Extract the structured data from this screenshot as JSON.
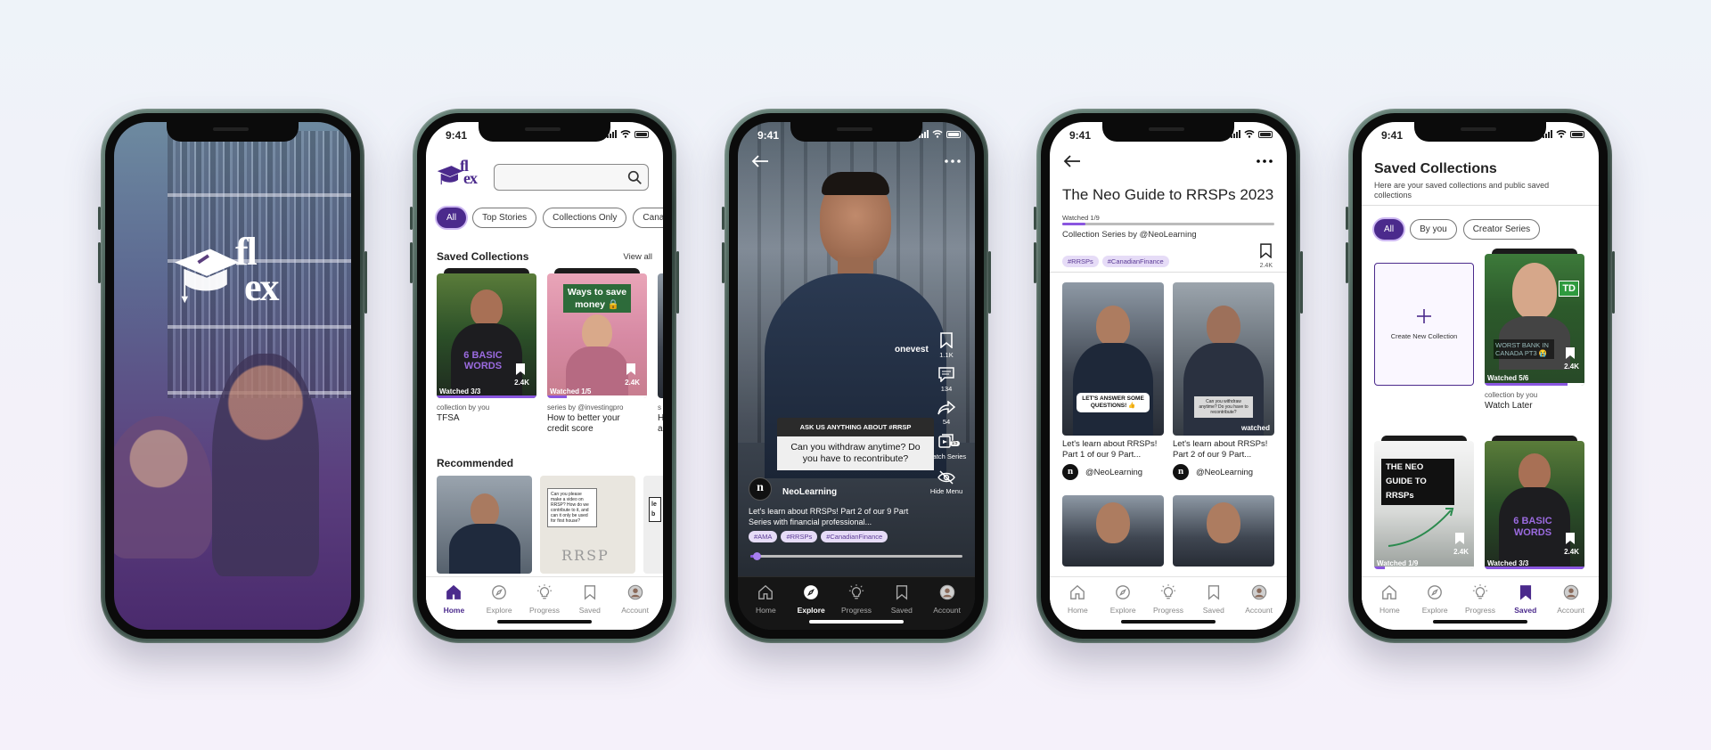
{
  "colors": {
    "brand": "#4b2a8c",
    "accent_light": "#cdb8f2",
    "tag_bg": "#e6dcf7"
  },
  "splash": {
    "logo_text": "flex",
    "logo_icon": "graduation-cap-icon"
  },
  "home": {
    "time": "9:41",
    "search": {
      "placeholder": "",
      "icon": "search-icon"
    },
    "filters": [
      "All",
      "Top Stories",
      "Collections Only",
      "Cana"
    ],
    "saved_section": {
      "title": "Saved Collections",
      "view_all": "View all"
    },
    "saved_cards": [
      {
        "thumb_text": "6 BASIC WORDS",
        "saves": "2.4K",
        "watched": "Watched 3/3",
        "progress": 1.0,
        "meta": "collection by you",
        "title": "TFSA"
      },
      {
        "thumb_text": "Ways to save money 🔒",
        "saves": "2.4K",
        "watched": "Watched 1/5",
        "progress": 0.2,
        "meta": "series by @investingpro",
        "title": "How to better your credit score"
      },
      {
        "meta": "s",
        "title": "H a"
      }
    ],
    "recommended_title": "Recommended",
    "rec_cards": [
      {
        "caption": ""
      },
      {
        "caption": "Can you please make a video on RRSP? How do we contribute to it, and can it only be used for first house?",
        "handwritten": "RRSP"
      },
      {
        "caption": "le b"
      }
    ]
  },
  "player": {
    "time": "9:41",
    "jersey_text": "onevest",
    "question_header": "ASK US ANYTHING ABOUT #RRSP",
    "question": "Can you withdraw anytime? Do you have to recontribute?",
    "channel": "NeoLearning",
    "channel_initial": "n",
    "description": "Let's learn about RRSPs! Part 2 of our 9 Part Series with financial professional...",
    "tags": [
      "#AMA",
      "#RRSPs",
      "#CanadianFinance"
    ],
    "progress": 0.03,
    "actions": [
      {
        "icon": "bookmark-icon",
        "label": "1.1K"
      },
      {
        "icon": "comment-icon",
        "label": "134"
      },
      {
        "icon": "share-icon",
        "label": "54"
      },
      {
        "icon": "series-icon",
        "label": "Watch Series",
        "badge": "15"
      },
      {
        "icon": "hide-icon",
        "label": "Hide Menu"
      }
    ]
  },
  "series": {
    "time": "9:41",
    "title": "The Neo Guide to RRSPs 2023",
    "watched": "Watched 1/9",
    "progress": 0.11,
    "by": "Collection Series by @NeoLearning",
    "tags": [
      "#RRSPs",
      "#CanadianFinance"
    ],
    "saves": "2.4K",
    "videos": [
      {
        "overlay": "LET'S ANSWER SOME QUESTIONS! 👍",
        "title": "Let's learn about RRSPs! Part 1 of our 9 Part...",
        "channel": "@NeoLearning",
        "watched": ""
      },
      {
        "overlay": "Can you withdraw anytime? Do you have to recontribute?",
        "title": "Let's learn about RRSPs! Part 2 of our 9 Part...",
        "channel": "@NeoLearning",
        "watched": "watched"
      }
    ]
  },
  "saved": {
    "time": "9:41",
    "title": "Saved Collections",
    "subtitle": "Here are your saved collections and public saved collections",
    "filters": [
      "All",
      "By you",
      "Creator Series"
    ],
    "create_label": "Create New Collection",
    "cards": [
      {
        "thumb_text": "WORST BANK IN CANADA PT3 😭",
        "badge": "TD",
        "saves": "2.4K",
        "watched": "Watched 5/6",
        "progress": 0.83,
        "meta": "collection by you",
        "title": "Watch Later"
      },
      {
        "thumb_text": "THE NEO GUIDE TO RRSPs",
        "saves": "2.4K",
        "watched": "Watched 1/9",
        "progress": 0.11
      },
      {
        "thumb_text": "6 BASIC WORDS",
        "saves": "2.4K",
        "watched": "Watched 3/3",
        "progress": 1.0
      }
    ]
  },
  "nav": [
    "Home",
    "Explore",
    "Progress",
    "Saved",
    "Account"
  ]
}
